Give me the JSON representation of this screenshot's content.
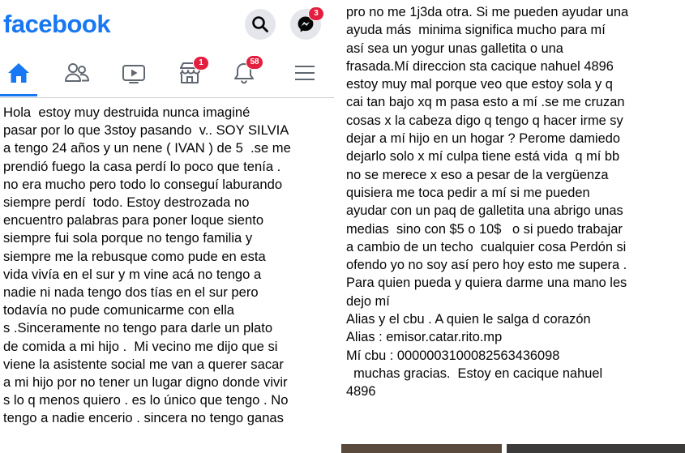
{
  "app": {
    "logo": "facebook"
  },
  "header": {
    "messenger_badge": "3"
  },
  "nav": {
    "tabs": [
      {
        "name": "home",
        "active": true
      },
      {
        "name": "friends"
      },
      {
        "name": "watch"
      },
      {
        "name": "marketplace",
        "badge": "1"
      },
      {
        "name": "notifications",
        "badge": "58"
      },
      {
        "name": "menu"
      }
    ]
  },
  "post": {
    "left_text": "Hola  estoy muy destruida nunca imaginé\npasar por lo que 3stoy pasando  v.. SOY SILVIA\na tengo 24 años y un nene ( IVAN ) de 5  .se me\nprendió fuego la casa perdí lo poco que tenía .\nno era mucho pero todo lo conseguí laburando\nsiempre perdí  todo. Estoy destrozada no\nencuentro palabras para poner loque siento\nsiempre fui sola porque no tengo familia y\nsiempre me la rebusque como pude en esta\nvida vivía en el sur y m vine acá no tengo a\nnadie ni nada tengo dos tías en el sur pero\ntodavía no pude comunicarme con ella\ns .Sinceramente no tengo para darle un plato\nde comida a mi hijo .  Mi vecino me dijo que si\nviene la asistente social me van a querer sacar\na mi hijo por no tener un lugar digno donde vivir\ns lo q menos quiero . es lo único que tengo . No\ntengo a nadie encerio . sincera no tengo ganas",
    "right_text": "pro no me 1j3da otra. Si me pueden ayudar una\nayuda más  minima significa mucho para mí\nasí sea un yogur unas galletita o una\nfrasada.Mí direccion sta cacique nahuel 4896\nestoy muy mal porque veo que estoy sola y q\ncai tan bajo xq m pasa esto a mí .se me cruzan\ncosas x la cabeza digo q tengo q hacer irme sy\ndejar a mí hijo en un hogar ? Perome damiedo\ndejarlo solo x mí culpa tiene está vida  q mí bb\nno se merece x eso a pesar de la vergüenza\nquisiera me toca pedir a mí si me pueden\nayudar con un paq de galletita una abrigo unas\nmedias  sino con $5 o 10$   o si puedo trabajar\na cambio de un techo  cualquier cosa Perdón si\nofendo yo no soy así pero hoy esto me supera .\nPara quien pueda y quiera darme una mano les\ndejo mí\nAlias y el cbu . A quien le salga d corazón\nAlias : emisor.catar.rito.mp\nMí cbu : 0000003100082563436098\n  muchas gracias.  Estoy en cacique nahuel\n4896"
  },
  "colors": {
    "brand": "#1877f2",
    "badge": "#e41e3f",
    "icon_gray": "#606770",
    "button_bg": "#e4e6eb"
  }
}
